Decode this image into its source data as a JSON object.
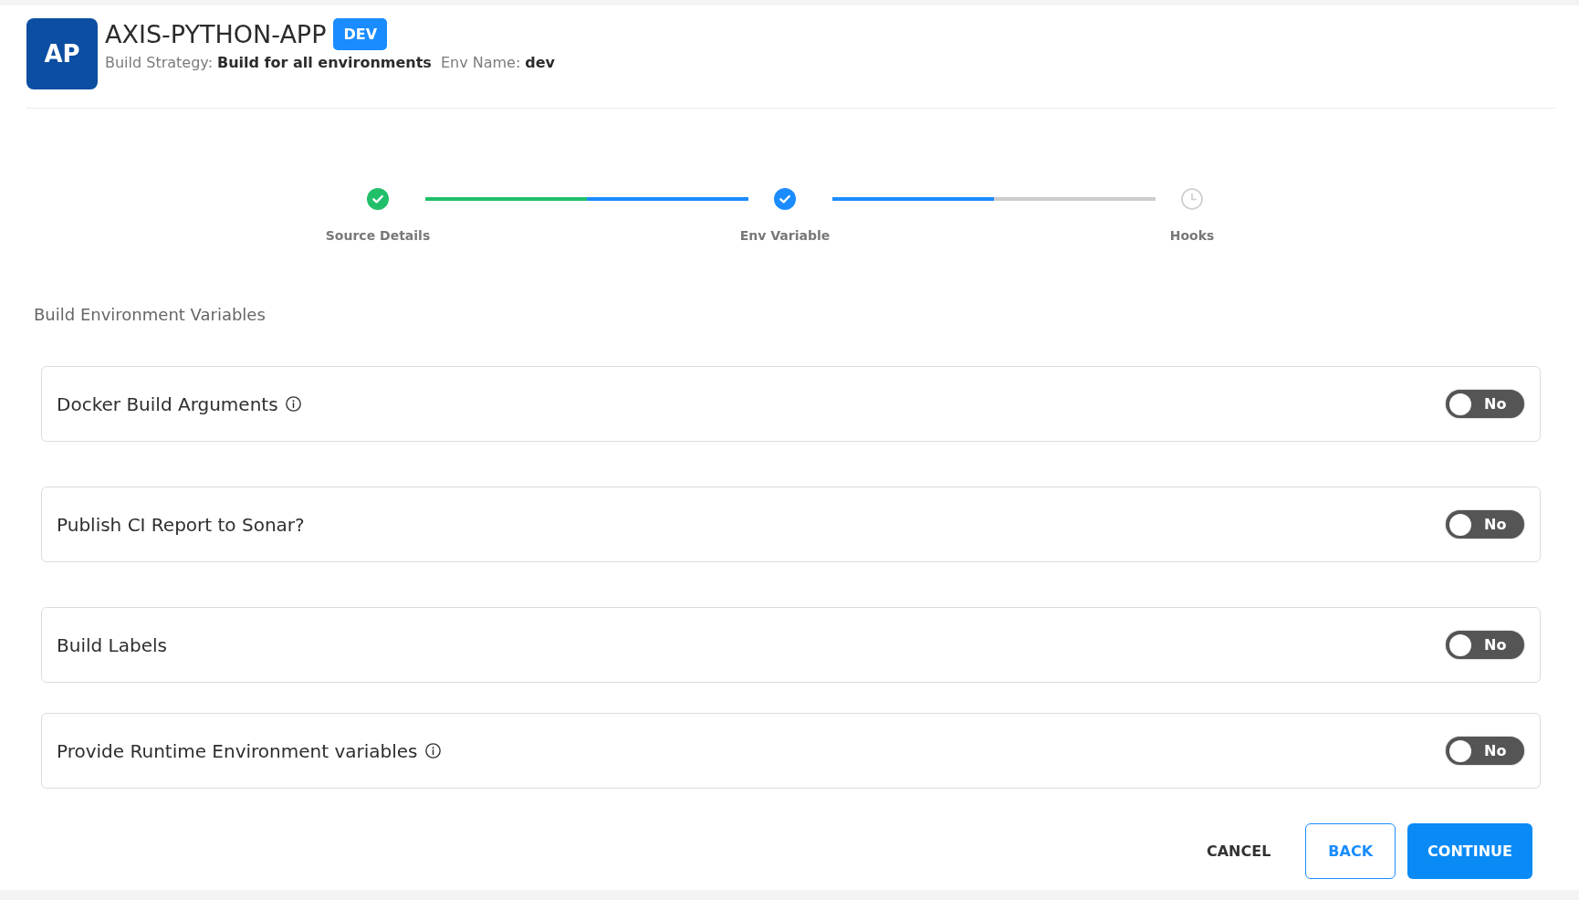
{
  "app": {
    "initials": "AP",
    "name": "AXIS-PYTHON-APP",
    "env_badge": "DEV",
    "build_strategy_label": "Build Strategy:",
    "build_strategy": "Build for all environments",
    "env_name_label": "Env Name:",
    "env_name": "dev"
  },
  "steps": [
    {
      "label": "Source Details",
      "done": true,
      "current": false
    },
    {
      "label": "Env Variable",
      "done": true,
      "current": true
    },
    {
      "label": "Hooks",
      "done": false,
      "current": false
    }
  ],
  "section_title": "Build Environment Variables",
  "options": [
    {
      "label": "Docker Build Arguments",
      "info": true,
      "on": false,
      "toggle_text": "No"
    },
    {
      "label": "Publish CI Report to Sonar?",
      "info": false,
      "on": false,
      "toggle_text": "No"
    },
    {
      "label": "Build Labels",
      "info": false,
      "on": false,
      "toggle_text": "No"
    },
    {
      "label": "Provide Runtime Environment variables",
      "info": true,
      "on": false,
      "toggle_text": "No"
    }
  ],
  "buttons": [
    {
      "label": "CANCEL",
      "kind": "text"
    },
    {
      "label": "BACK",
      "kind": "outline"
    },
    {
      "label": "CONTINUE",
      "kind": "primary"
    }
  ]
}
